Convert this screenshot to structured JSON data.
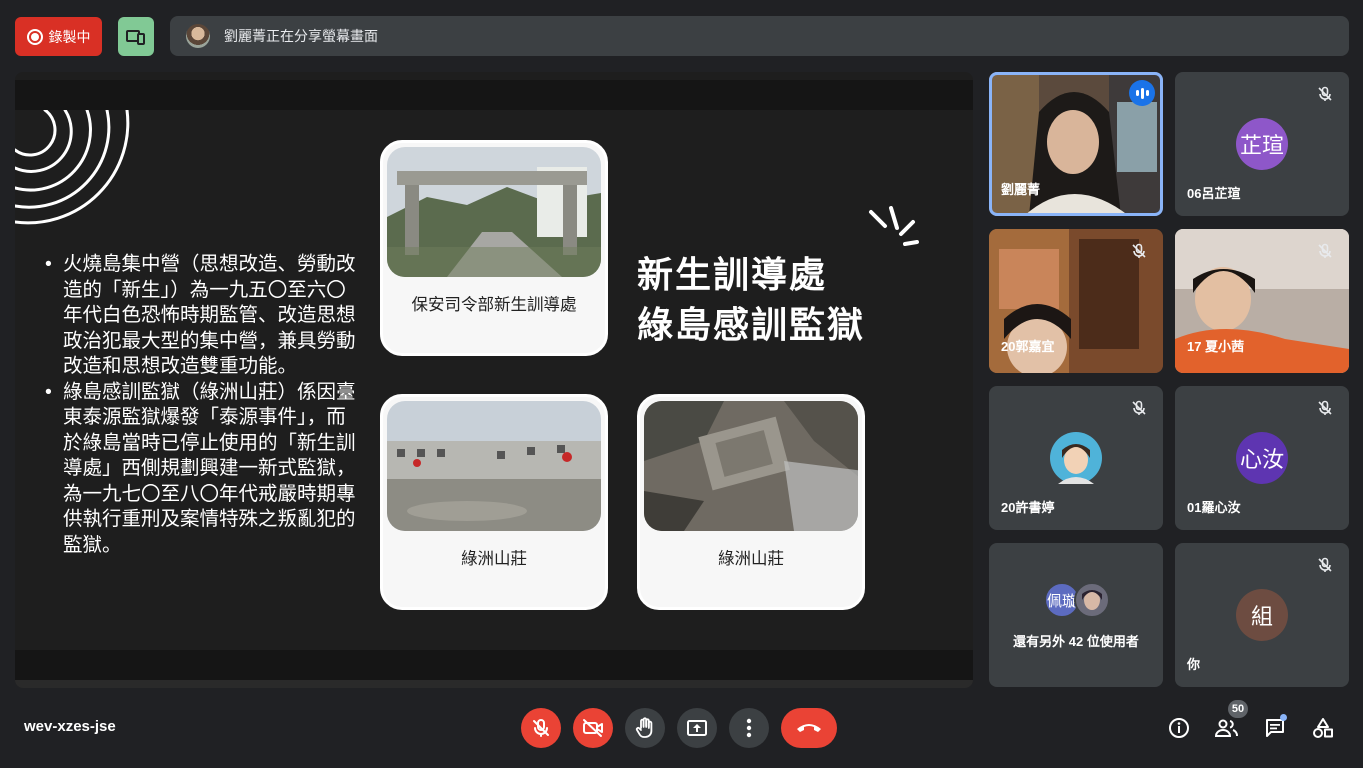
{
  "topbar": {
    "recording_label": "錄製中",
    "share_text": "劉麗菁正在分享螢幕畫面"
  },
  "slide": {
    "title_line1": "新生訓導處",
    "title_line2": "綠島感訓監獄",
    "bullets": [
      "火燒島集中營（思想改造、勞動改造的「新生」）為一九五〇至六〇年代白色恐怖時期監管、改造思想政治犯最大型的集中營，兼具勞動改造和思想改造雙重功能。",
      "綠島感訓監獄（綠洲山莊）係因臺東泰源監獄爆發「泰源事件」，而於綠島當時已停止使用的「新生訓導處」西側規劃興建一新式監獄，為一九七〇至八〇年代戒嚴時期專供執行重刑及案情特殊之叛亂犯的監獄。"
    ],
    "cards": [
      {
        "caption": "保安司令部新生訓導處"
      },
      {
        "caption": "綠洲山莊"
      },
      {
        "caption": "綠洲山莊"
      }
    ]
  },
  "participants": [
    {
      "name": "劉麗菁",
      "speaking": true
    },
    {
      "name": "06呂芷瑄",
      "avatar_text": "芷瑄",
      "avatar_color": "#8e57c9",
      "muted": true
    },
    {
      "name": "20郭嘉宜",
      "muted": true
    },
    {
      "name": "17 夏小茜",
      "muted": true
    },
    {
      "name": "20許書婷",
      "muted": true
    },
    {
      "name": "01羅心汝",
      "avatar_text": "心汝",
      "avatar_color": "#5e35b1",
      "muted": true
    },
    {
      "name": "還有另外 42 位使用者",
      "avatar_text": "佩璇",
      "avatar_color": "#5c6bc0"
    },
    {
      "name": "你",
      "avatar_text": "組",
      "avatar_color": "#6d4c41",
      "muted": true
    }
  ],
  "bottombar": {
    "meeting_code": "wev-xzes-jse",
    "people_count": "50"
  },
  "colors": {
    "danger": "#ea4335",
    "tile": "#3c4043",
    "accent": "#8ab4f8"
  }
}
